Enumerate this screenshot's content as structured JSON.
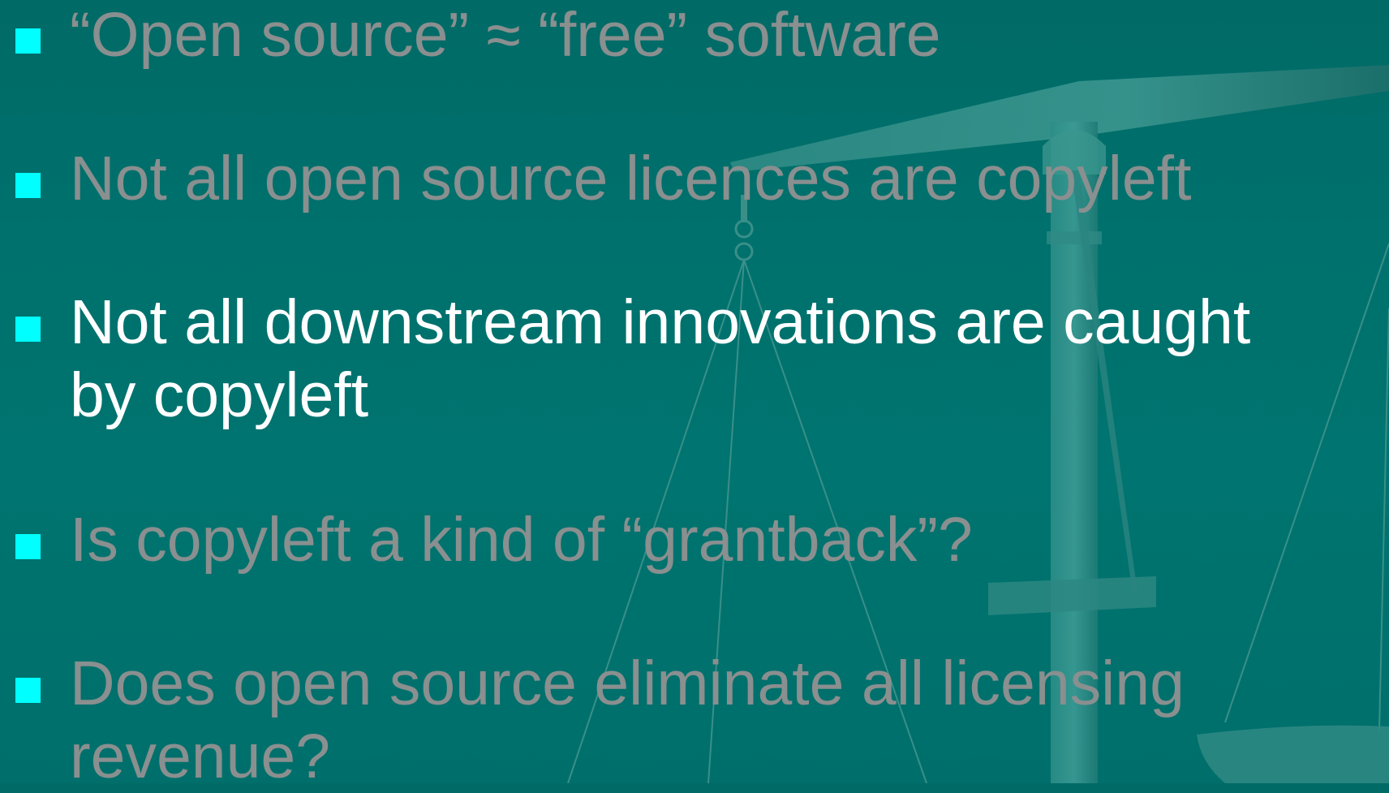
{
  "slide": {
    "bullets": [
      {
        "lines": [
          "“Open source” ≈ “free” software"
        ],
        "active": false
      },
      {
        "lines": [
          "Not all open source licences are copyleft"
        ],
        "active": false
      },
      {
        "lines": [
          "Not all downstream innovations are caught",
          "by copyleft"
        ],
        "active": true
      },
      {
        "lines": [
          "Is copyleft a kind of “grantback”?"
        ],
        "active": false
      },
      {
        "lines": [
          "Does open source eliminate all licensing",
          "revenue?"
        ],
        "active": false
      }
    ],
    "colors": {
      "background": "#00706c",
      "bullet_marker": "#00ffff",
      "active_text": "#ffffff",
      "dimmed_text": "#8a8f8f"
    },
    "background_icon": "scales-of-justice-icon"
  }
}
